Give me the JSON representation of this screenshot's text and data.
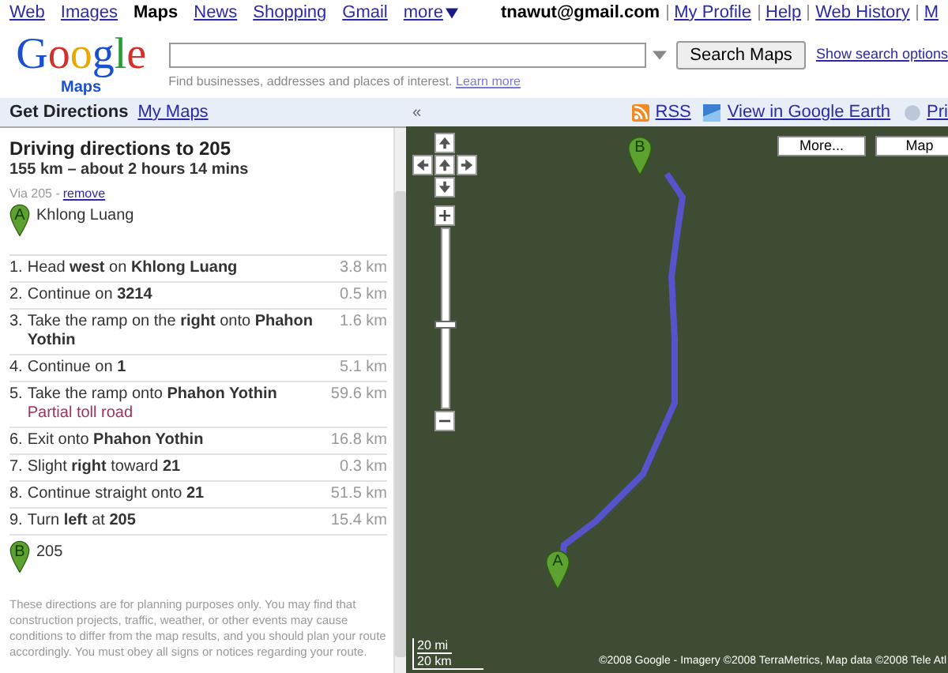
{
  "top_nav": {
    "links": [
      {
        "label": "Web",
        "selected": false
      },
      {
        "label": "Images",
        "selected": false
      },
      {
        "label": "Maps",
        "selected": true
      },
      {
        "label": "News",
        "selected": false
      },
      {
        "label": "Shopping",
        "selected": false
      },
      {
        "label": "Gmail",
        "selected": false
      }
    ],
    "more": "more",
    "account": "tnawut@gmail.com",
    "account_links": [
      "My Profile",
      "Help",
      "Web History",
      "M"
    ]
  },
  "logo": {
    "word": "Google",
    "product": "Maps"
  },
  "search": {
    "button": "Search Maps",
    "options_link": "Show search options",
    "hint": "Find businesses, addresses and places of interest.",
    "hint_link": "Learn more"
  },
  "tabs": [
    {
      "label": "Get Directions",
      "selected": true
    },
    {
      "label": "My Maps",
      "selected": false
    }
  ],
  "collapse": "«",
  "map_links": [
    "RSS",
    "View in Google Earth",
    "Pri"
  ],
  "directions": {
    "title": "Driving directions to 205",
    "summary": "155 km – about 2 hours 14 mins",
    "via": "Via 205 -",
    "via_link": "remove",
    "start": {
      "marker": "A",
      "name": "Khlong Luang"
    },
    "steps": [
      {
        "number": "1.",
        "text": "Head **west** on **Khlong Luang**",
        "distance": "3.8 km"
      },
      {
        "number": "2.",
        "text": "Continue on **3214**",
        "distance": "0.5 km"
      },
      {
        "number": "3.",
        "text": "Take the ramp on the **right** onto **Phahon Yothin**",
        "distance": "1.6 km"
      },
      {
        "number": "4.",
        "text": "Continue on **1**",
        "distance": "5.1 km"
      },
      {
        "number": "5.",
        "text": "Take the ramp onto **Phahon Yothin**",
        "note": "Partial toll road",
        "distance": "59.6 km"
      },
      {
        "number": "6.",
        "text": "Exit onto **Phahon Yothin**",
        "distance": "16.8 km"
      },
      {
        "number": "7.",
        "text": "Slight **right** toward **21**",
        "distance": "0.3 km"
      },
      {
        "number": "8.",
        "text": "Continue straight onto **21**",
        "distance": "51.5 km"
      },
      {
        "number": "9.",
        "text": "Turn **left** at **205**",
        "distance": "15.4 km"
      }
    ],
    "end": {
      "marker": "B",
      "name": "205"
    },
    "disclaimer": "These directions are for planning purposes only. You may find that construction projects, traffic, weather, or other events may cause conditions to differ from the map results, and you should plan your route accordingly. You must obey all signs or notices regarding your route."
  },
  "map": {
    "buttons": [
      {
        "label": "More...",
        "selected": false
      },
      {
        "label": "Map",
        "selected": false
      }
    ],
    "zoom": {
      "level": 0.47
    },
    "markers": [
      {
        "label": "B"
      },
      {
        "label": "A"
      }
    ],
    "scale": [
      "20 mi",
      "20 km"
    ],
    "copyright": "©2008 Google - Imagery ©2008 TerraMetrics, Map data ©2008 Tele Atl"
  }
}
